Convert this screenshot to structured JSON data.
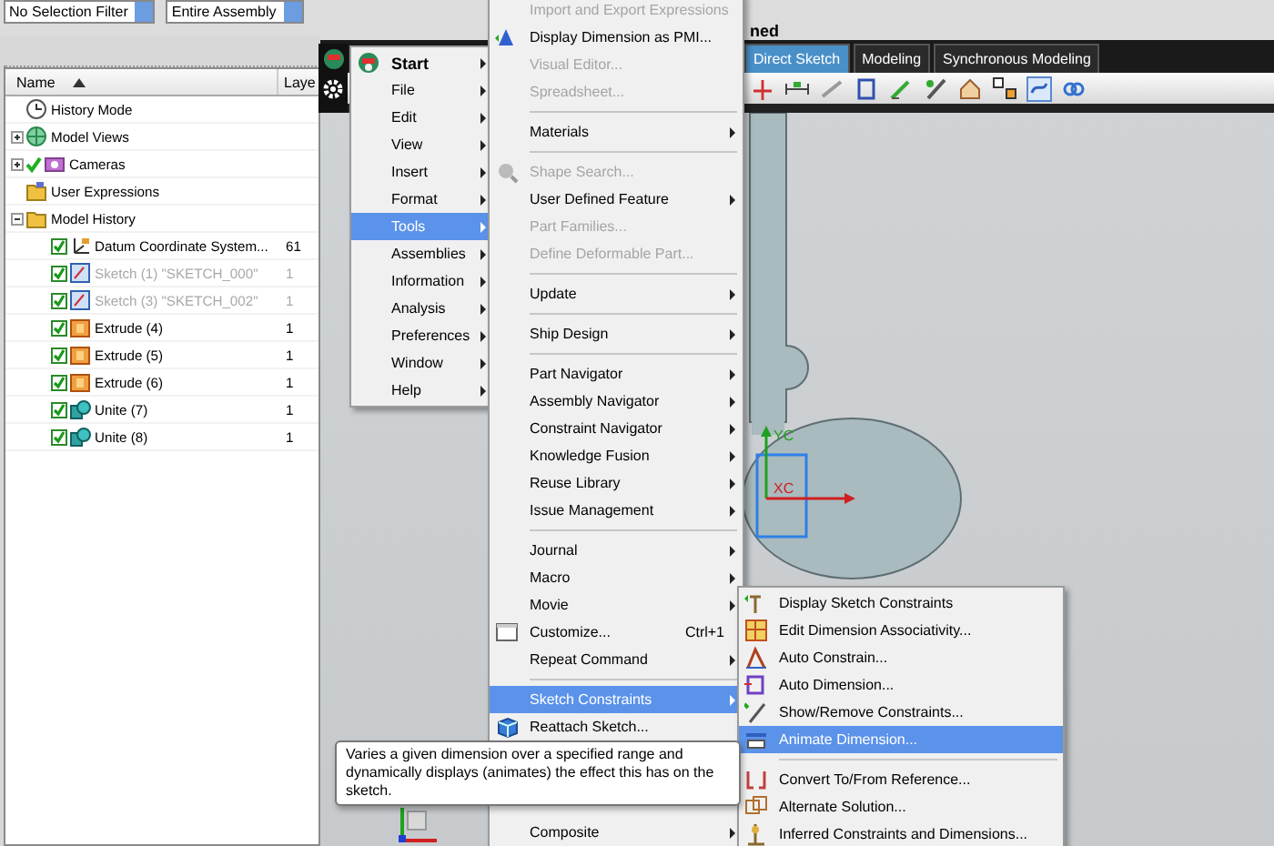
{
  "top_bar": {
    "selection_filter": "No Selection Filter",
    "assembly_scope": "Entire Assembly",
    "title_fragment": "ned"
  },
  "navigator": {
    "columns": [
      "Name",
      "Laye"
    ],
    "tree": [
      {
        "label": "History Mode",
        "kind": "history"
      },
      {
        "label": "Model Views",
        "kind": "views",
        "expanded": false
      },
      {
        "label": "Cameras",
        "kind": "cameras",
        "expanded": false,
        "visible": true
      },
      {
        "label": "User Expressions",
        "kind": "expressions"
      },
      {
        "label": "Model History",
        "kind": "folder",
        "expanded": true,
        "children": [
          {
            "label": "Datum Coordinate System...",
            "kind": "datum",
            "layer": "61",
            "checked": true,
            "disabled": false
          },
          {
            "label": "Sketch (1) \"SKETCH_000\"",
            "kind": "sketch",
            "layer": "1",
            "checked": true,
            "disabled": true
          },
          {
            "label": "Sketch (3) \"SKETCH_002\"",
            "kind": "sketch",
            "layer": "1",
            "checked": true,
            "disabled": true
          },
          {
            "label": "Extrude (4)",
            "kind": "extrude",
            "layer": "1",
            "checked": true,
            "disabled": false
          },
          {
            "label": "Extrude (5)",
            "kind": "extrude",
            "layer": "1",
            "checked": true,
            "disabled": false
          },
          {
            "label": "Extrude (6)",
            "kind": "extrude",
            "layer": "1",
            "checked": true,
            "disabled": false
          },
          {
            "label": "Unite (7)",
            "kind": "unite",
            "layer": "1",
            "checked": true,
            "disabled": false
          },
          {
            "label": "Unite (8)",
            "kind": "unite",
            "layer": "1",
            "checked": true,
            "disabled": false
          }
        ]
      }
    ]
  },
  "tabs": [
    {
      "label": "Direct Sketch",
      "selected": true
    },
    {
      "label": "Modeling",
      "selected": false
    },
    {
      "label": "Synchronous Modeling",
      "selected": false
    }
  ],
  "canvas": {
    "axis_labels": [
      "YC",
      "XC"
    ]
  },
  "main_menu": [
    {
      "label": "Start",
      "kind": "start",
      "selected": false
    },
    {
      "label": "File",
      "kind": "item",
      "selected": false
    },
    {
      "label": "Edit",
      "kind": "item",
      "selected": false
    },
    {
      "label": "View",
      "kind": "item",
      "selected": false
    },
    {
      "label": "Insert",
      "kind": "item",
      "selected": false
    },
    {
      "label": "Format",
      "kind": "item",
      "selected": false
    },
    {
      "label": "Tools",
      "kind": "item",
      "selected": true
    },
    {
      "label": "Assemblies",
      "kind": "item",
      "selected": false
    },
    {
      "label": "Information",
      "kind": "item",
      "selected": false
    },
    {
      "label": "Analysis",
      "kind": "item",
      "selected": false
    },
    {
      "label": "Preferences",
      "kind": "item",
      "selected": false
    },
    {
      "label": "Window",
      "kind": "item",
      "selected": false
    },
    {
      "label": "Help",
      "kind": "item",
      "selected": false
    }
  ],
  "tools_menu": {
    "items": [
      {
        "kind": "item",
        "label": "Import and Export Expressions",
        "disabled": true,
        "submenu": false,
        "selected": false
      },
      {
        "kind": "item",
        "label": "Display Dimension as PMI...",
        "disabled": false,
        "submenu": false,
        "selected": false,
        "icon": true
      },
      {
        "kind": "item",
        "label": "Visual Editor...",
        "disabled": true,
        "submenu": false,
        "selected": false
      },
      {
        "kind": "item",
        "label": "Spreadsheet...",
        "disabled": true,
        "submenu": false,
        "selected": false
      },
      {
        "kind": "separator"
      },
      {
        "kind": "item",
        "label": "Materials",
        "disabled": false,
        "submenu": true,
        "selected": false
      },
      {
        "kind": "separator"
      },
      {
        "kind": "item",
        "label": "Shape Search...",
        "disabled": true,
        "submenu": false,
        "selected": false,
        "icon": true
      },
      {
        "kind": "item",
        "label": "User Defined Feature",
        "disabled": false,
        "submenu": true,
        "selected": false
      },
      {
        "kind": "item",
        "label": "Part Families...",
        "disabled": true,
        "submenu": false,
        "selected": false
      },
      {
        "kind": "item",
        "label": "Define Deformable Part...",
        "disabled": true,
        "submenu": false,
        "selected": false
      },
      {
        "kind": "separator"
      },
      {
        "kind": "item",
        "label": "Update",
        "disabled": false,
        "submenu": true,
        "selected": false
      },
      {
        "kind": "separator"
      },
      {
        "kind": "item",
        "label": "Ship Design",
        "disabled": false,
        "submenu": true,
        "selected": false
      },
      {
        "kind": "separator"
      },
      {
        "kind": "item",
        "label": "Part Navigator",
        "disabled": false,
        "submenu": true,
        "selected": false
      },
      {
        "kind": "item",
        "label": "Assembly Navigator",
        "disabled": false,
        "submenu": true,
        "selected": false
      },
      {
        "kind": "item",
        "label": "Constraint Navigator",
        "disabled": false,
        "submenu": true,
        "selected": false
      },
      {
        "kind": "item",
        "label": "Knowledge Fusion",
        "disabled": false,
        "submenu": true,
        "selected": false
      },
      {
        "kind": "item",
        "label": "Reuse Library",
        "disabled": false,
        "submenu": true,
        "selected": false
      },
      {
        "kind": "item",
        "label": "Issue Management",
        "disabled": false,
        "submenu": true,
        "selected": false
      },
      {
        "kind": "separator"
      },
      {
        "kind": "item",
        "label": "Journal",
        "disabled": false,
        "submenu": true,
        "selected": false
      },
      {
        "kind": "item",
        "label": "Macro",
        "disabled": false,
        "submenu": true,
        "selected": false
      },
      {
        "kind": "item",
        "label": "Movie",
        "disabled": false,
        "submenu": true,
        "selected": false
      },
      {
        "kind": "item",
        "label": "Customize...",
        "shortcut": "Ctrl+1",
        "disabled": false,
        "submenu": false,
        "selected": false,
        "icon": true
      },
      {
        "kind": "item",
        "label": "Repeat Command",
        "disabled": false,
        "submenu": true,
        "selected": false
      },
      {
        "kind": "separator"
      },
      {
        "kind": "item",
        "label": "Sketch Constraints",
        "disabled": false,
        "submenu": true,
        "selected": true
      },
      {
        "kind": "item",
        "label": "Reattach Sketch...",
        "disabled": false,
        "submenu": false,
        "selected": false,
        "icon": true
      }
    ],
    "items_below_tooltip": [
      {
        "kind": "item",
        "label": "Composite",
        "disabled": false,
        "submenu": true,
        "selected": false
      }
    ]
  },
  "sketch_constraints_menu": [
    {
      "kind": "item",
      "label": "Display Sketch Constraints",
      "disabled": false,
      "submenu": false,
      "selected": false,
      "icon": true
    },
    {
      "kind": "item",
      "label": "Edit Dimension Associativity...",
      "disabled": false,
      "submenu": false,
      "selected": false,
      "icon": true
    },
    {
      "kind": "item",
      "label": "Auto Constrain...",
      "disabled": false,
      "submenu": false,
      "selected": false,
      "icon": true
    },
    {
      "kind": "item",
      "label": "Auto Dimension...",
      "disabled": false,
      "submenu": false,
      "selected": false,
      "icon": true
    },
    {
      "kind": "item",
      "label": "Show/Remove Constraints...",
      "disabled": false,
      "submenu": false,
      "selected": false,
      "icon": true
    },
    {
      "kind": "item",
      "label": "Animate Dimension...",
      "disabled": false,
      "submenu": false,
      "selected": true,
      "icon": true
    },
    {
      "kind": "separator"
    },
    {
      "kind": "item",
      "label": "Convert To/From Reference...",
      "disabled": false,
      "submenu": false,
      "selected": false,
      "icon": true
    },
    {
      "kind": "item",
      "label": "Alternate Solution...",
      "disabled": false,
      "submenu": false,
      "selected": false,
      "icon": true
    },
    {
      "kind": "item",
      "label": "Inferred Constraints and Dimensions...",
      "disabled": false,
      "submenu": false,
      "selected": false,
      "icon": true
    }
  ],
  "tooltip": "Varies a given dimension over a specified range and dynamically displays (animates) the effect this has on the sketch."
}
